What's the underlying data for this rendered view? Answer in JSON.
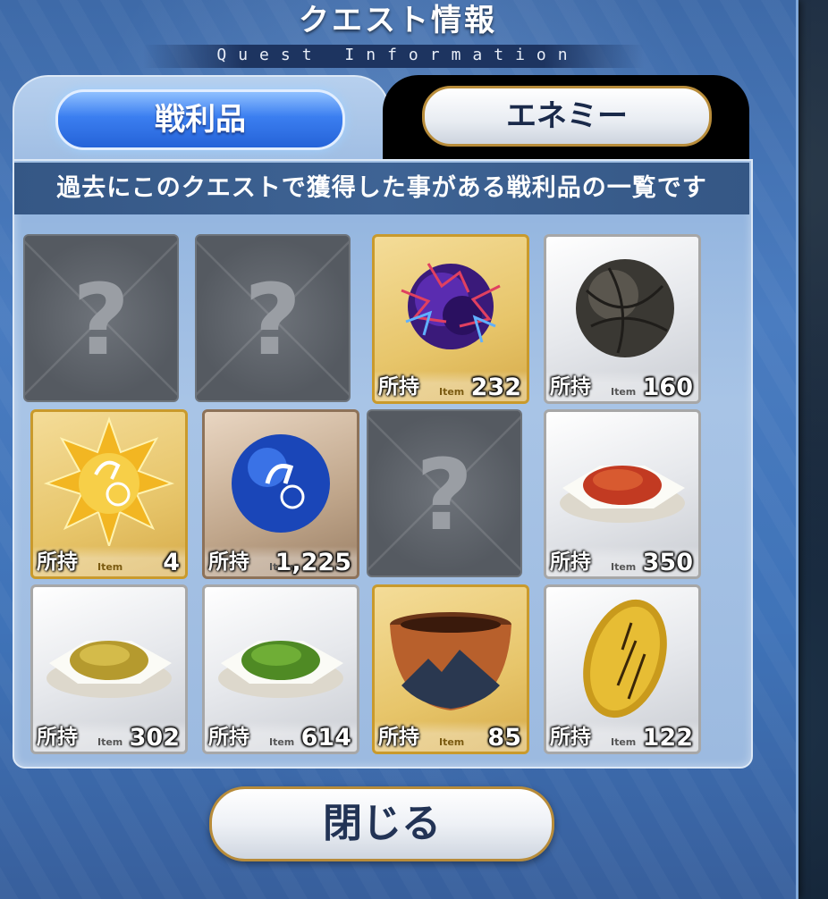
{
  "header": {
    "title": "クエスト情報",
    "subtitle": "Quest Information"
  },
  "tabs": [
    {
      "label": "戦利品",
      "active": true
    },
    {
      "label": "エネミー",
      "active": false
    }
  ],
  "description": "過去にこのクエストで獲得した事がある戦利品の一覧です",
  "hold_label": "所持",
  "item_tag": "Item",
  "items": [
    {
      "known": false
    },
    {
      "known": false
    },
    {
      "known": true,
      "name": "lightning-orb",
      "frame": "gold",
      "count": "232"
    },
    {
      "known": true,
      "name": "stone-sphere",
      "frame": "silver",
      "count": "160"
    },
    {
      "known": true,
      "name": "gold-rider-star",
      "frame": "gold",
      "count": "4"
    },
    {
      "known": true,
      "name": "blue-rider-orb",
      "frame": "bronze",
      "count": "1,225"
    },
    {
      "known": false
    },
    {
      "known": true,
      "name": "red-herb",
      "frame": "silver",
      "count": "350"
    },
    {
      "known": true,
      "name": "yellow-herb",
      "frame": "silver",
      "count": "302"
    },
    {
      "known": true,
      "name": "green-herb",
      "frame": "silver",
      "count": "614"
    },
    {
      "known": true,
      "name": "tea-bowl",
      "frame": "gold",
      "count": "85"
    },
    {
      "known": true,
      "name": "gold-coin",
      "frame": "silver",
      "count": "122"
    }
  ],
  "close_button": "閉じる"
}
